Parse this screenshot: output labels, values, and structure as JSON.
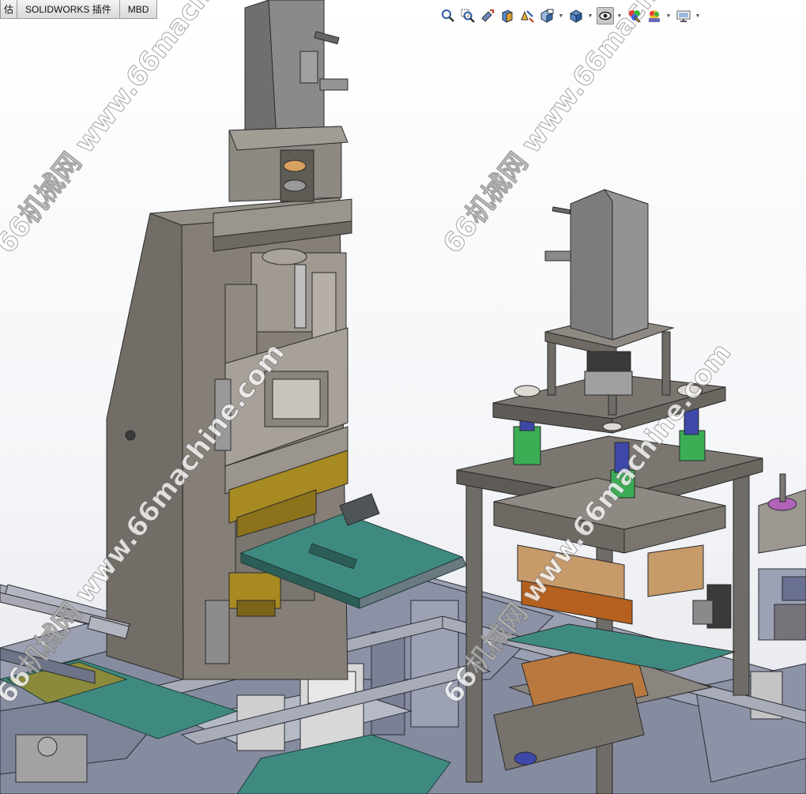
{
  "command_tabs": [
    {
      "label": "估"
    },
    {
      "label": "SOLIDWORKS 插件"
    },
    {
      "label": "MBD"
    }
  ],
  "view_toolbar": {
    "tools": [
      {
        "name": "zoom-to-fit-icon"
      },
      {
        "name": "zoom-to-area-icon"
      },
      {
        "name": "previous-view-icon"
      },
      {
        "name": "section-view-icon"
      },
      {
        "name": "dynamic-annotation-icon"
      },
      {
        "name": "view-orientation-icon",
        "dropdown": true
      },
      {
        "name": "display-style-icon",
        "dropdown": true
      },
      {
        "name": "hide-show-items-icon",
        "dropdown": true,
        "active": true
      },
      {
        "name": "edit-appearance-icon"
      },
      {
        "name": "apply-scene-icon",
        "dropdown": true
      },
      {
        "name": "view-settings-icon",
        "dropdown": true
      }
    ]
  },
  "watermarks": [
    {
      "text": "66机械网 www.66machine.com"
    },
    {
      "text": "66机械网 www.66machine.com"
    },
    {
      "text": "66机械网 www.66machine.com"
    },
    {
      "text": "66机械网 www.66machine.com"
    }
  ],
  "colors": {
    "metal_gray": "#7b7670",
    "teal_plate": "#3f8a80",
    "brass": "#a88a22",
    "copper": "#b8783e",
    "green_bushing": "#3bae55",
    "blue_shaft": "#3e48a8",
    "frame_blue_gray": "#8b93a8",
    "magenta_part": "#b063b8"
  }
}
